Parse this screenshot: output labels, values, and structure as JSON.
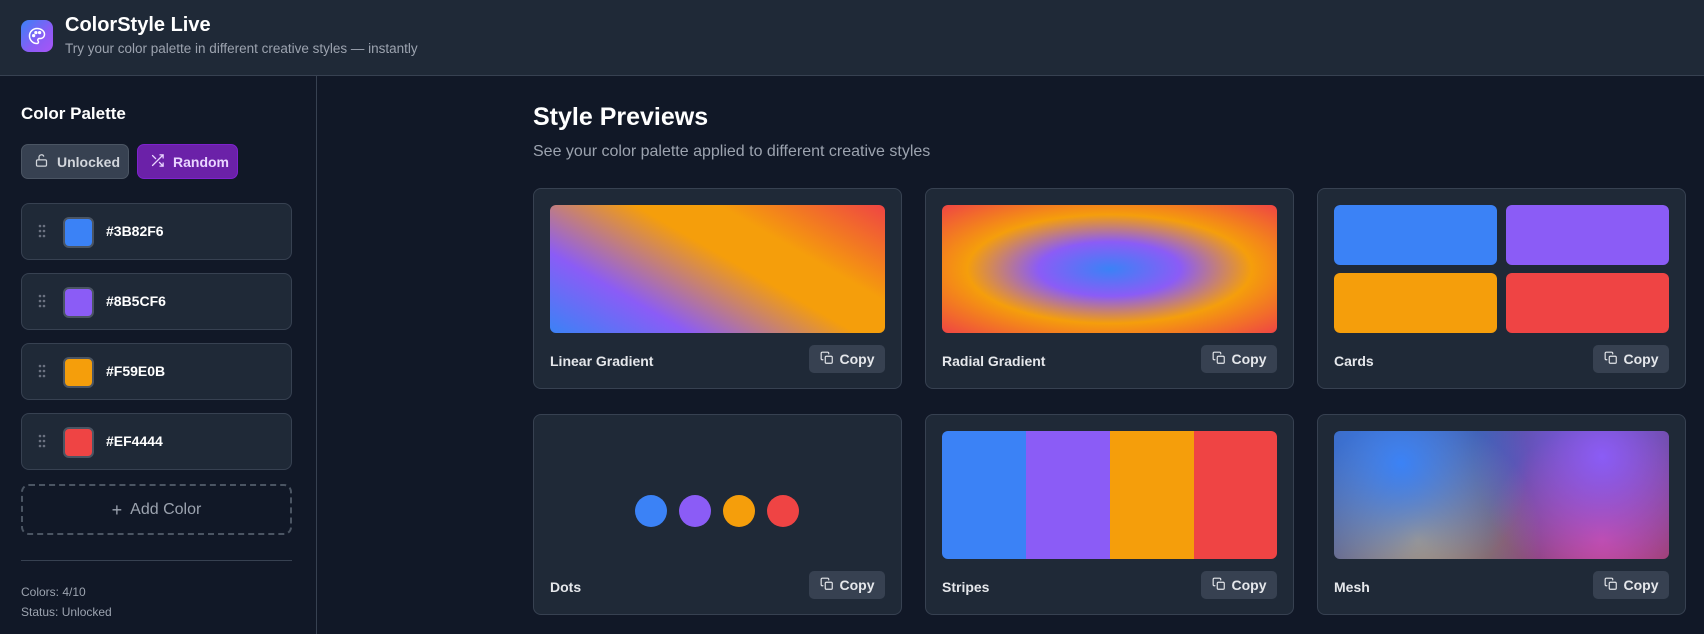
{
  "header": {
    "title": "ColorStyle Live",
    "subtitle": "Try your color palette in different creative styles — instantly"
  },
  "sidebar": {
    "title": "Color Palette",
    "unlocked_label": "Unlocked",
    "random_label": "Random",
    "colors": [
      {
        "hex": "#3B82F6",
        "value": "#3B82F6"
      },
      {
        "hex": "#8B5CF6",
        "value": "#8B5CF6"
      },
      {
        "hex": "#F59E0B",
        "value": "#F59E0B"
      },
      {
        "hex": "#EF4444",
        "value": "#EF4444"
      }
    ],
    "add_color_label": "Add Color",
    "stats": {
      "colors": "Colors: 4/10",
      "status": "Status: Unlocked"
    }
  },
  "main": {
    "title": "Style Previews",
    "subtitle": "See your color palette applied to different creative styles",
    "copy_label": "Copy",
    "styles": [
      {
        "label": "Linear Gradient"
      },
      {
        "label": "Radial Gradient"
      },
      {
        "label": "Cards"
      },
      {
        "label": "Dots"
      },
      {
        "label": "Stripes"
      },
      {
        "label": "Mesh"
      }
    ]
  },
  "icons": {
    "logo": "palette-icon",
    "unlocked": "unlock-icon",
    "random": "shuffle-icon",
    "drag": "grip-icon",
    "add": "plus-icon",
    "copy": "copy-icon"
  },
  "colors": {
    "background": "#111827",
    "panel": "#1f2937",
    "accent": "#6b21a8"
  }
}
